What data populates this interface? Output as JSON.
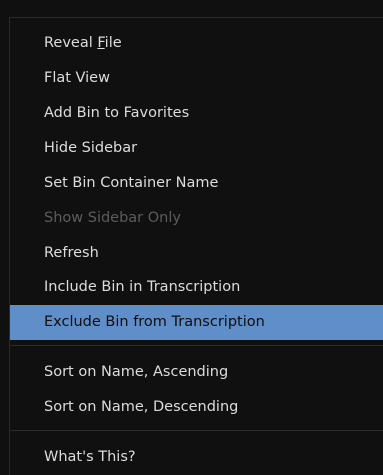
{
  "menu": {
    "groups": [
      {
        "items": [
          {
            "pre": "Reveal ",
            "u": "F",
            "post": "ile",
            "state": "normal"
          },
          {
            "pre": "Flat View",
            "u": "",
            "post": "",
            "state": "normal"
          },
          {
            "pre": "Add Bin to Favorites",
            "u": "",
            "post": "",
            "state": "normal"
          },
          {
            "pre": "Hide Sidebar",
            "u": "",
            "post": "",
            "state": "normal"
          },
          {
            "pre": "Set Bin Container Name",
            "u": "",
            "post": "",
            "state": "normal"
          },
          {
            "pre": "Show Sidebar Only",
            "u": "",
            "post": "",
            "state": "disabled"
          },
          {
            "pre": "Refresh",
            "u": "",
            "post": "",
            "state": "normal"
          },
          {
            "pre": "Include Bin in Transcription",
            "u": "",
            "post": "",
            "state": "normal"
          },
          {
            "pre": "Exclude Bin from Transcription",
            "u": "",
            "post": "",
            "state": "highlighted"
          }
        ]
      },
      {
        "items": [
          {
            "pre": "Sort on Name, Ascending",
            "u": "",
            "post": "",
            "state": "normal"
          },
          {
            "pre": "Sort on Name, Descending",
            "u": "",
            "post": "",
            "state": "normal"
          }
        ]
      },
      {
        "items": [
          {
            "pre": "What's This?",
            "u": "",
            "post": "",
            "state": "normal"
          }
        ]
      }
    ],
    "colors": {
      "background": "#101010",
      "text": "#dcdcdc",
      "disabled_text": "#5c5c5c",
      "highlight": "#5f8ec8",
      "highlight_text": "#0e0e0e"
    }
  }
}
